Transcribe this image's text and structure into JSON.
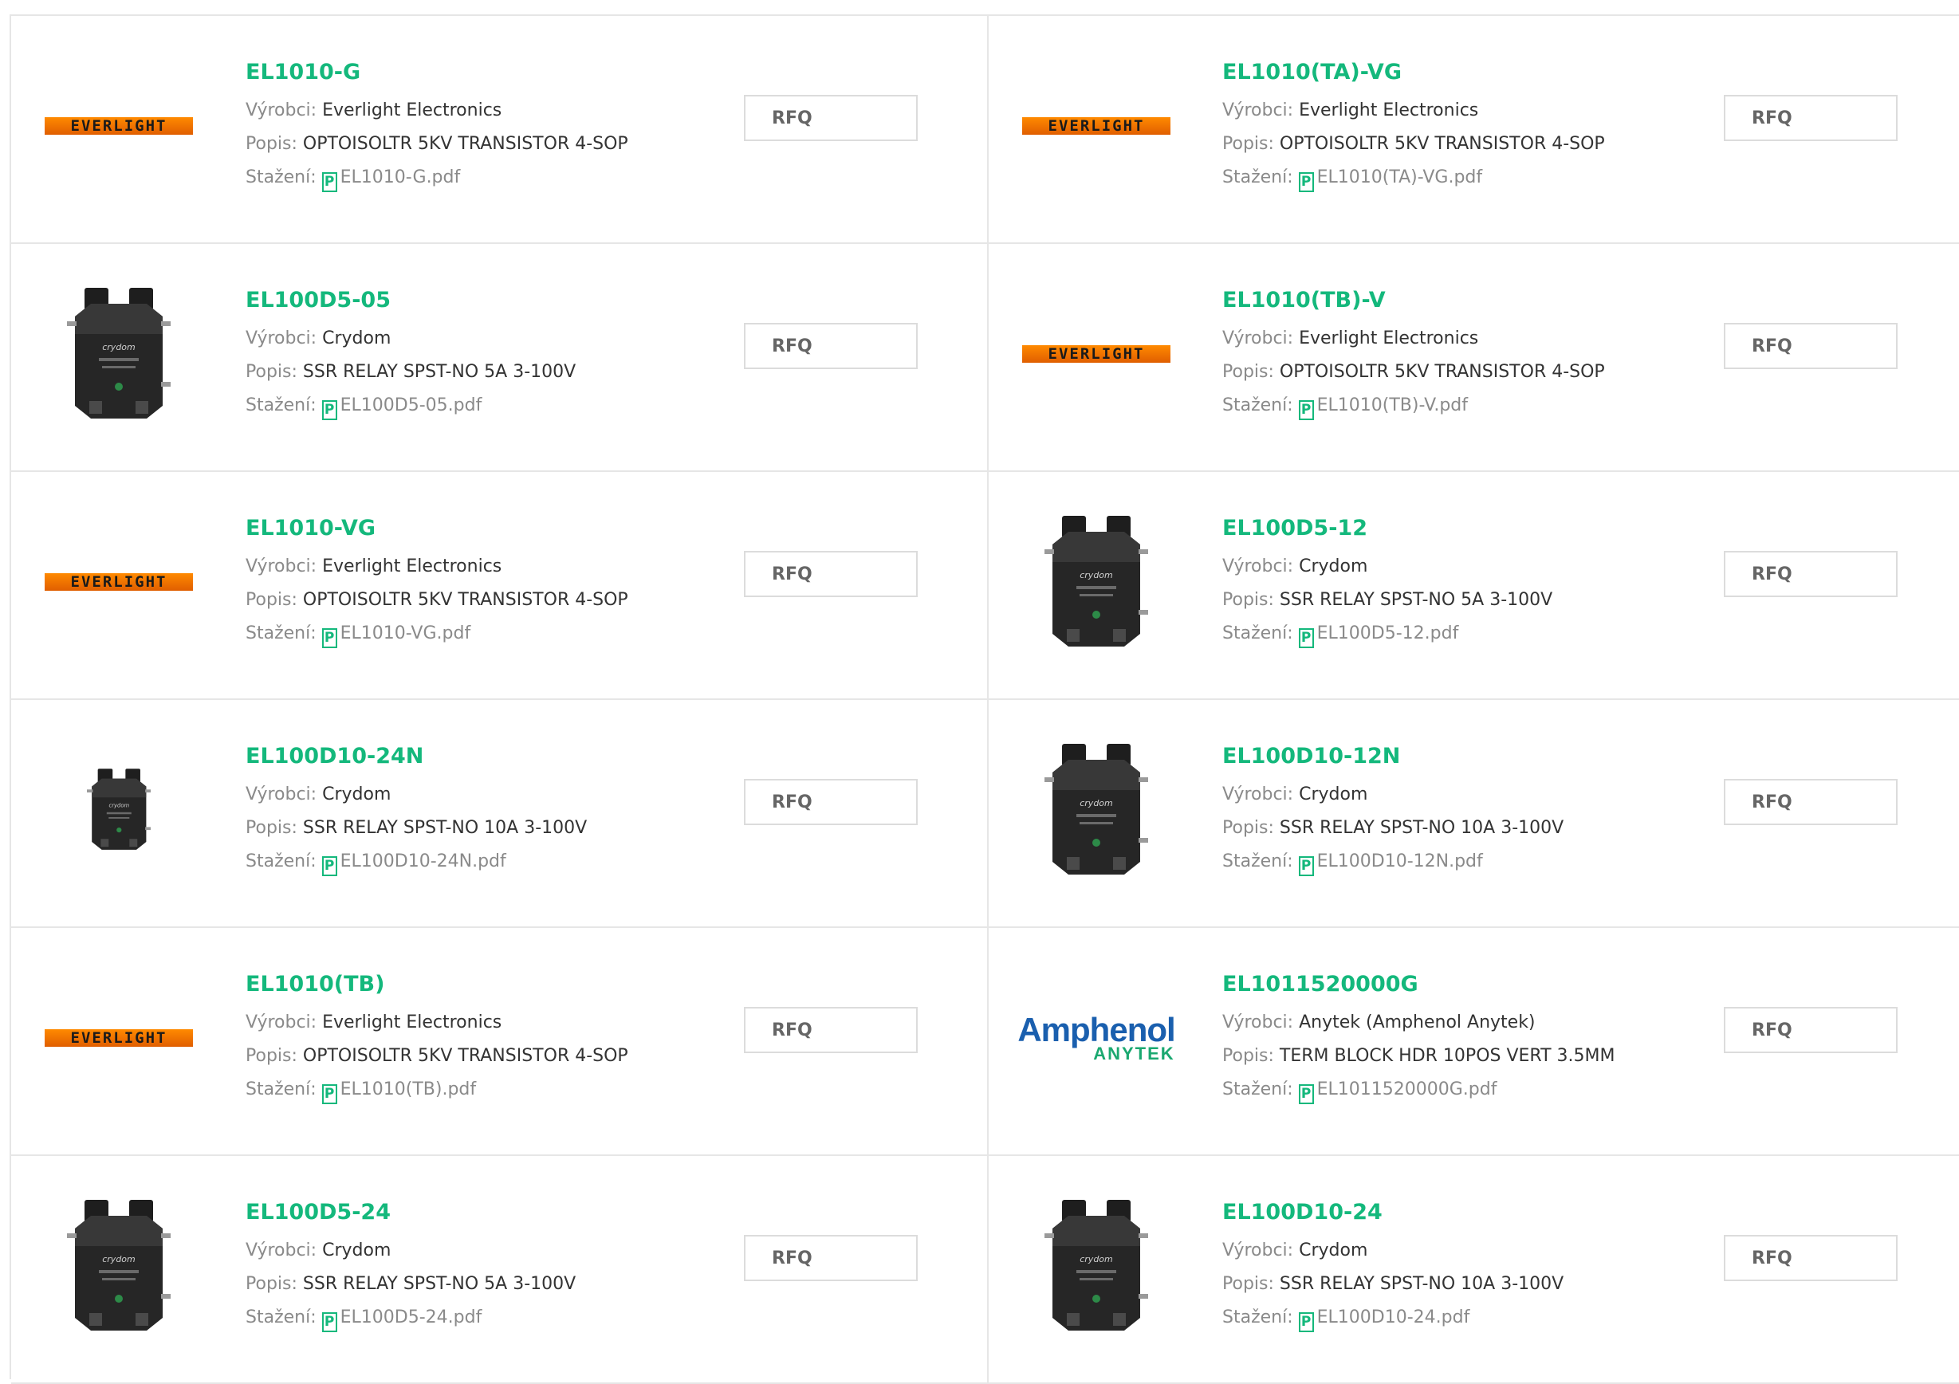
{
  "labels": {
    "manufacturer": "Výrobci:",
    "description": "Popis:",
    "download": "Stažení:",
    "rfq": "RFQ"
  },
  "logos": {
    "everlight": "EVERLIGHT",
    "amphenol": "Amphenol",
    "anytek": "ANYTEK"
  },
  "colors": {
    "accent": "#14b87c",
    "everlight_orange": "#ff8a00",
    "amphenol_blue": "#1a5fae"
  },
  "products": [
    {
      "part": "EL1010-G",
      "manufacturer": "Everlight Electronics",
      "description": "OPTOISOLTR 5KV TRANSISTOR 4-SOP",
      "pdf": "EL1010-G.pdf",
      "image": "everlight-logo"
    },
    {
      "part": "EL1010(TA)-VG",
      "manufacturer": "Everlight Electronics",
      "description": "OPTOISOLTR 5KV TRANSISTOR 4-SOP",
      "pdf": "EL1010(TA)-VG.pdf",
      "image": "everlight-logo"
    },
    {
      "part": "EL100D5-05",
      "manufacturer": "Crydom",
      "description": "SSR RELAY SPST-NO 5A 3-100V",
      "pdf": "EL100D5-05.pdf",
      "image": "relay-photo"
    },
    {
      "part": "EL1010(TB)-V",
      "manufacturer": "Everlight Electronics",
      "description": "OPTOISOLTR 5KV TRANSISTOR 4-SOP",
      "pdf": "EL1010(TB)-V.pdf",
      "image": "everlight-logo"
    },
    {
      "part": "EL1010-VG",
      "manufacturer": "Everlight Electronics",
      "description": "OPTOISOLTR 5KV TRANSISTOR 4-SOP",
      "pdf": "EL1010-VG.pdf",
      "image": "everlight-logo"
    },
    {
      "part": "EL100D5-12",
      "manufacturer": "Crydom",
      "description": "SSR RELAY SPST-NO 5A 3-100V",
      "pdf": "EL100D5-12.pdf",
      "image": "relay-photo"
    },
    {
      "part": "EL100D10-24N",
      "manufacturer": "Crydom",
      "description": "SSR RELAY SPST-NO 10A 3-100V",
      "pdf": "EL100D10-24N.pdf",
      "image": "relay-photo-small"
    },
    {
      "part": "EL100D10-12N",
      "manufacturer": "Crydom",
      "description": "SSR RELAY SPST-NO 10A 3-100V",
      "pdf": "EL100D10-12N.pdf",
      "image": "relay-photo"
    },
    {
      "part": "EL1010(TB)",
      "manufacturer": "Everlight Electronics",
      "description": "OPTOISOLTR 5KV TRANSISTOR 4-SOP",
      "pdf": "EL1010(TB).pdf",
      "image": "everlight-logo"
    },
    {
      "part": "EL1011520000G",
      "manufacturer": "Anytek (Amphenol Anytek)",
      "description": "TERM BLOCK HDR 10POS VERT 3.5MM",
      "pdf": "EL1011520000G.pdf",
      "image": "amphenol-logo"
    },
    {
      "part": "EL100D5-24",
      "manufacturer": "Crydom",
      "description": "SSR RELAY SPST-NO 5A 3-100V",
      "pdf": "EL100D5-24.pdf",
      "image": "relay-photo"
    },
    {
      "part": "EL100D10-24",
      "manufacturer": "Crydom",
      "description": "SSR RELAY SPST-NO 10A 3-100V",
      "pdf": "EL100D10-24.pdf",
      "image": "relay-photo"
    }
  ]
}
